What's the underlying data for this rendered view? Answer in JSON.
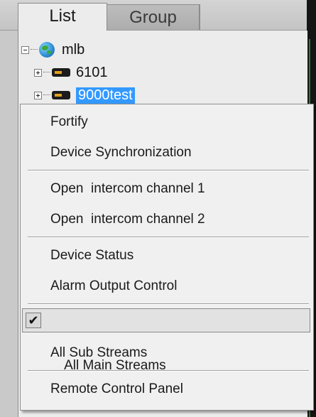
{
  "tabs": {
    "list": "List",
    "group": "Group"
  },
  "tree": {
    "root_label": "mlb",
    "devices": [
      "6101",
      "9000test"
    ]
  },
  "menu": {
    "items": [
      "Fortify",
      "Device Synchronization",
      "Open  intercom channel 1",
      "Open  intercom channel 2",
      "Device Status",
      "Alarm Output Control",
      "All Main Streams",
      "All Sub Streams",
      "Remote Control Panel"
    ],
    "checked_item": "All Main Streams",
    "check_glyph": "✔"
  },
  "colors": {
    "selection": "#3399ff",
    "menu_background": "#f0f0f0"
  },
  "icons": {
    "root": "globe-icon",
    "device": "device-icon",
    "expander_root": "collapse-icon",
    "expander_device": "expand-icon",
    "checked": "checkmark-icon"
  }
}
